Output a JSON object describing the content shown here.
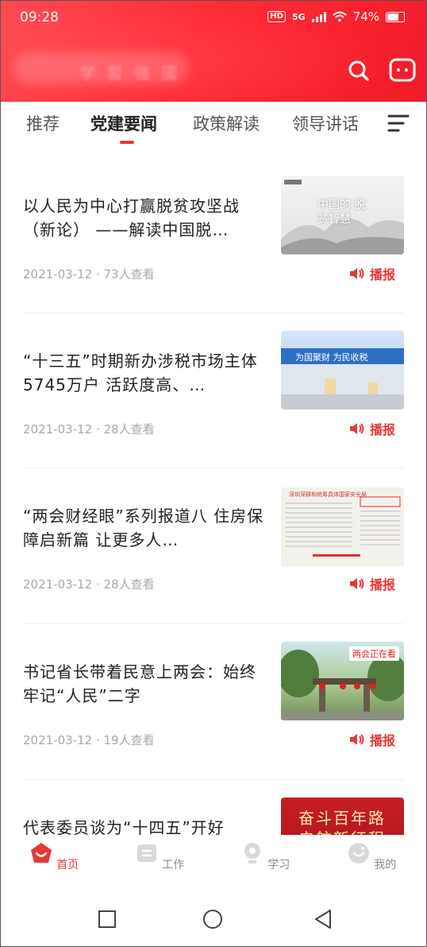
{
  "status_bar": {
    "time": "09:28",
    "hd": "HD",
    "network": "5G",
    "battery": "74%"
  },
  "header": {
    "brand_text": "学 習 強 國"
  },
  "tabs": [
    {
      "label": "推荐"
    },
    {
      "label": "党建要闻"
    },
    {
      "label": "政策解读"
    },
    {
      "label": "领导讲话"
    }
  ],
  "articles": [
    {
      "title": "以人民为中心打赢脱贫攻坚战（新论） ——解读中国脱…",
      "meta": "2021-03-12 · 73人查看",
      "play_label": "播报",
      "thumb_text": "中国的 脱贫智慧"
    },
    {
      "title": "“十三五”时期新办涉税市场主体5745万户 活跃度高、…",
      "meta": "2021-03-12 · 28人查看",
      "play_label": "播报",
      "thumb_text": "为国聚财 为民收税"
    },
    {
      "title": "“两会财经眼”系列报道八 住房保障启新篇 让更多人…",
      "meta": "2021-03-12 · 28人查看",
      "play_label": "播报",
      "thumb_text": "深圳深耕和统筹具体国家安全局"
    },
    {
      "title": "书记省长带着民意上两会：始终牢记“人民”二字",
      "meta": "2021-03-12 · 19人查看",
      "play_label": "播报",
      "thumb_text": "两会正在看"
    },
    {
      "title": "代表委员谈为“十四五”开好",
      "meta": "",
      "play_label": "",
      "thumb_text": "奋斗百年路 启航新征程"
    }
  ],
  "bottom_nav": [
    {
      "label": "首页",
      "active": true
    },
    {
      "label": "工作",
      "active": false
    },
    {
      "label": "学习",
      "active": false
    },
    {
      "label": "我的",
      "active": false
    }
  ],
  "colors": {
    "accent": "#e53935",
    "header_red": "#ff2c37"
  }
}
